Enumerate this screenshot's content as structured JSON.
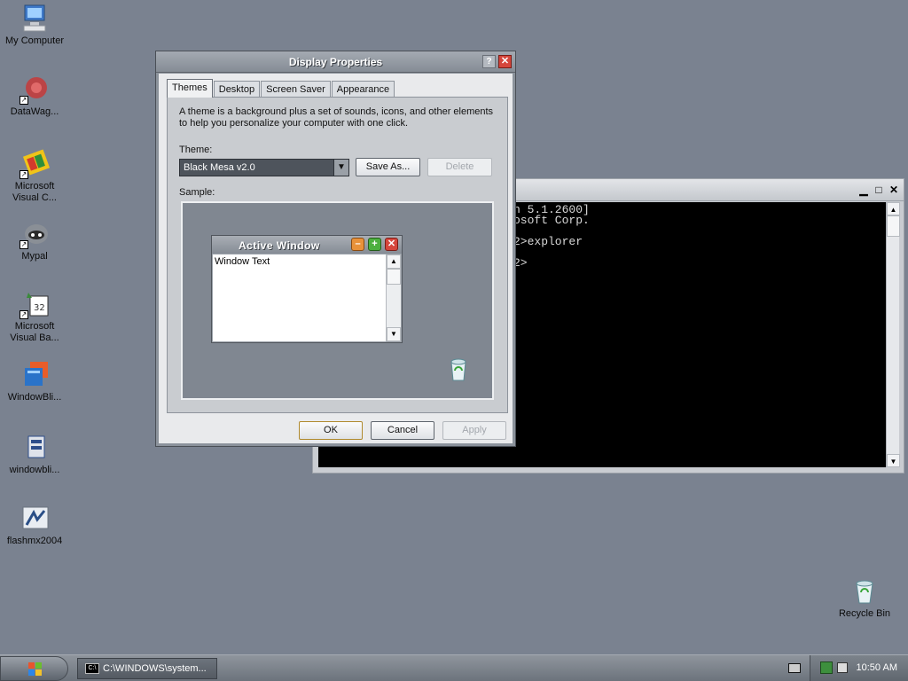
{
  "desktop": {
    "icons": [
      {
        "label": "My Computer",
        "icon": "my-computer-icon"
      },
      {
        "label": "DataWag...",
        "icon": "datawag-icon"
      },
      {
        "label": "Microsoft Visual C...",
        "icon": "visual-c-icon"
      },
      {
        "label": "Mypal",
        "icon": "mypal-icon"
      },
      {
        "label": "Microsoft Visual Ba...",
        "icon": "visual-basic-icon"
      },
      {
        "label": "WindowBli...",
        "icon": "windowblinds-icon"
      },
      {
        "label": "windowbli...",
        "icon": "windowblinds-installer-icon"
      },
      {
        "label": "flashmx2004",
        "icon": "flash-mx-icon"
      },
      {
        "label": "Recycle Bin",
        "icon": "recycle-bin-icon"
      }
    ]
  },
  "console": {
    "lines": [
      "n 5.1.2600]",
      "osoft Corp.",
      "",
      "2>explorer",
      "",
      "2>"
    ]
  },
  "dialog": {
    "title": "Display Properties",
    "help_glyph": "?",
    "close_glyph": "✕",
    "tabs": [
      "Themes",
      "Desktop",
      "Screen Saver",
      "Appearance"
    ],
    "description": "A theme is a background plus a set of sounds, icons, and other elements to help you personalize your computer with one click.",
    "theme_label": "Theme:",
    "theme_value": "Black Mesa v2.0",
    "save_as": "Save As...",
    "delete": "Delete",
    "sample_label": "Sample:",
    "sample_window_title": "Active Window",
    "sample_window_text": "Window Text",
    "ok": "OK",
    "cancel": "Cancel",
    "apply": "Apply"
  },
  "taskbar": {
    "task_label": "C:\\WINDOWS\\system...",
    "clock": "10:50 AM"
  }
}
